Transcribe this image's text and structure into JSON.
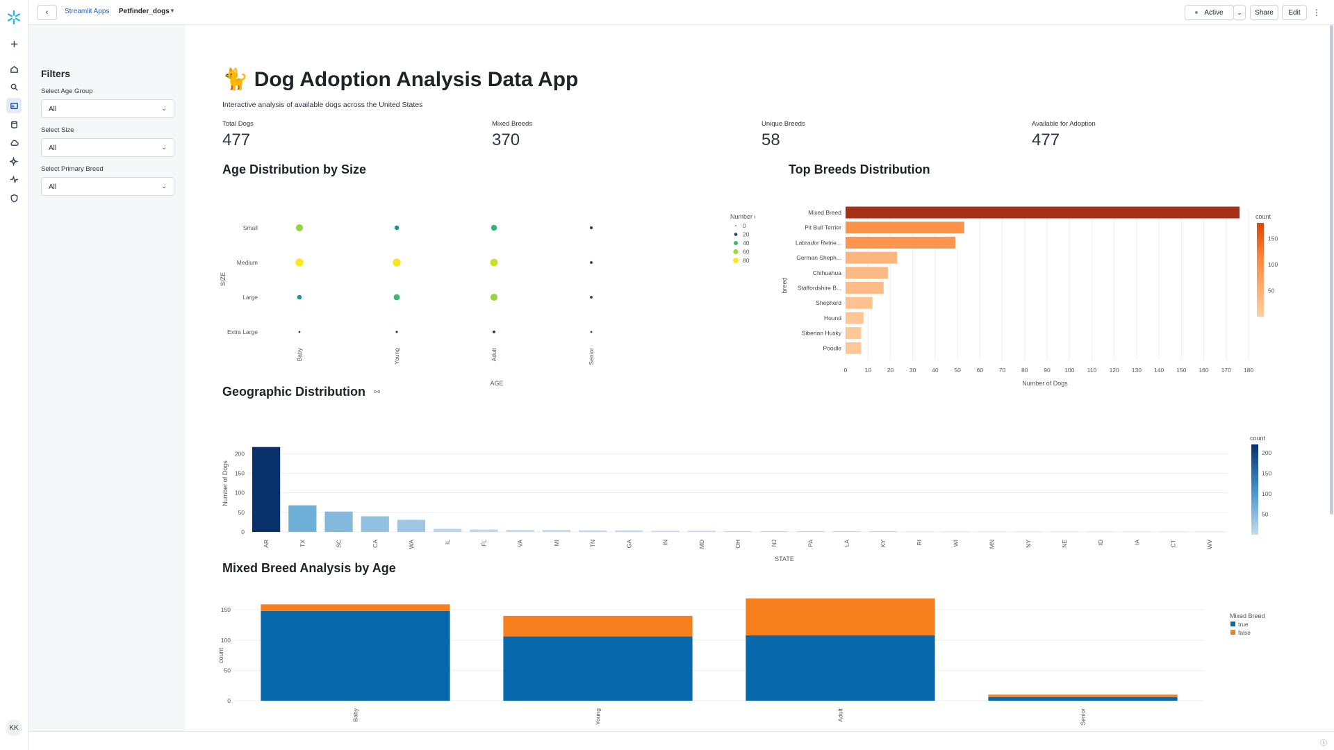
{
  "topbar": {
    "crumb_root": "Streamlit Apps",
    "crumb_app": "Petfinder_dogs",
    "status": "Active",
    "share_label": "Share",
    "edit_label": "Edit"
  },
  "rail": {
    "avatar": "KK"
  },
  "sidebar": {
    "title": "Filters",
    "filters": [
      {
        "label": "Select Age Group",
        "value": "All"
      },
      {
        "label": "Select Size",
        "value": "All"
      },
      {
        "label": "Select Primary Breed",
        "value": "All"
      }
    ]
  },
  "main": {
    "title": "🐈 Dog Adoption Analysis Data App",
    "subtitle": "Interactive analysis of available dogs across the United States",
    "metrics": [
      {
        "label": "Total Dogs",
        "value": "477"
      },
      {
        "label": "Mixed Breeds",
        "value": "370"
      },
      {
        "label": "Unique Breeds",
        "value": "58"
      },
      {
        "label": "Available for Adoption",
        "value": "477"
      }
    ],
    "sections": {
      "age_size": "Age Distribution by Size",
      "top_breeds": "Top Breeds Distribution",
      "geo": "Geographic Distribution",
      "mixed": "Mixed Breed Analysis by Age"
    }
  },
  "chart_data": [
    {
      "id": "age_size",
      "type": "scatter",
      "xlabel": "AGE",
      "ylabel": "SIZE",
      "x_categories": [
        "Baby",
        "Young",
        "Adult",
        "Senior"
      ],
      "y_categories": [
        "Small",
        "Medium",
        "Large",
        "Extra Large"
      ],
      "legend_title": "Number of Dogs",
      "legend_values": [
        0,
        20,
        40,
        60,
        80
      ],
      "points": [
        {
          "x": "Baby",
          "y": "Small",
          "value": 58
        },
        {
          "x": "Young",
          "y": "Small",
          "value": 20
        },
        {
          "x": "Adult",
          "y": "Small",
          "value": 38
        },
        {
          "x": "Senior",
          "y": "Small",
          "value": 5
        },
        {
          "x": "Baby",
          "y": "Medium",
          "value": 80
        },
        {
          "x": "Young",
          "y": "Medium",
          "value": 78
        },
        {
          "x": "Adult",
          "y": "Medium",
          "value": 68
        },
        {
          "x": "Senior",
          "y": "Medium",
          "value": 4
        },
        {
          "x": "Baby",
          "y": "Large",
          "value": 20
        },
        {
          "x": "Young",
          "y": "Large",
          "value": 40
        },
        {
          "x": "Adult",
          "y": "Large",
          "value": 58
        },
        {
          "x": "Senior",
          "y": "Large",
          "value": 4
        },
        {
          "x": "Baby",
          "y": "Extra Large",
          "value": 1
        },
        {
          "x": "Young",
          "y": "Extra Large",
          "value": 2
        },
        {
          "x": "Adult",
          "y": "Extra Large",
          "value": 5
        },
        {
          "x": "Senior",
          "y": "Extra Large",
          "value": 1
        }
      ]
    },
    {
      "id": "top_breeds",
      "type": "bar",
      "orientation": "horizontal",
      "xlabel": "Number of Dogs",
      "ylabel": "breed",
      "xlim": [
        0,
        180
      ],
      "x_ticks": [
        0,
        10,
        20,
        30,
        40,
        50,
        60,
        70,
        80,
        90,
        100,
        110,
        120,
        130,
        140,
        150,
        160,
        170,
        180
      ],
      "legend_title": "count",
      "legend_ticks": [
        50,
        100,
        150
      ],
      "categories": [
        "Mixed Breed",
        "Pit Bull Terrier",
        "Labrador Retrie...",
        "German Sheph...",
        "Chihuahua",
        "Staffordshire B...",
        "Shepherd",
        "Hound",
        "Siberian Husky",
        "Poodle"
      ],
      "values": [
        176,
        53,
        49,
        23,
        19,
        17,
        12,
        8,
        7,
        7
      ]
    },
    {
      "id": "geo",
      "type": "bar",
      "xlabel": "STATE",
      "ylabel": "Number of Dogs",
      "ylim": [
        0,
        220
      ],
      "y_ticks": [
        0,
        50,
        100,
        150,
        200
      ],
      "legend_title": "count",
      "legend_ticks": [
        50,
        100,
        150,
        200
      ],
      "categories": [
        "AR",
        "TX",
        "SC",
        "CA",
        "WA",
        "IL",
        "FL",
        "VA",
        "MI",
        "TN",
        "GA",
        "IN",
        "MD",
        "OH",
        "NJ",
        "PA",
        "LA",
        "KY",
        "RI",
        "WI",
        "MN",
        "NY",
        "NE",
        "ID",
        "IA",
        "CT",
        "WV"
      ],
      "values": [
        217,
        68,
        52,
        40,
        31,
        8,
        6,
        5,
        5,
        4,
        4,
        3,
        3,
        2,
        2,
        2,
        2,
        2,
        1,
        1,
        1,
        1,
        1,
        1,
        1,
        1,
        1
      ]
    },
    {
      "id": "mixed",
      "type": "bar",
      "stacked": true,
      "xlabel": "AGE",
      "ylabel": "count",
      "ylim": [
        0,
        180
      ],
      "y_ticks": [
        0,
        50,
        100,
        150
      ],
      "categories": [
        "Baby",
        "Young",
        "Adult",
        "Senior"
      ],
      "legend_title": "Mixed Breed",
      "series": [
        {
          "name": "true",
          "color": "#0868ac",
          "values": [
            148,
            106,
            108,
            6
          ]
        },
        {
          "name": "false",
          "color": "#f77f1e",
          "values": [
            11,
            34,
            61,
            4
          ]
        }
      ]
    }
  ]
}
